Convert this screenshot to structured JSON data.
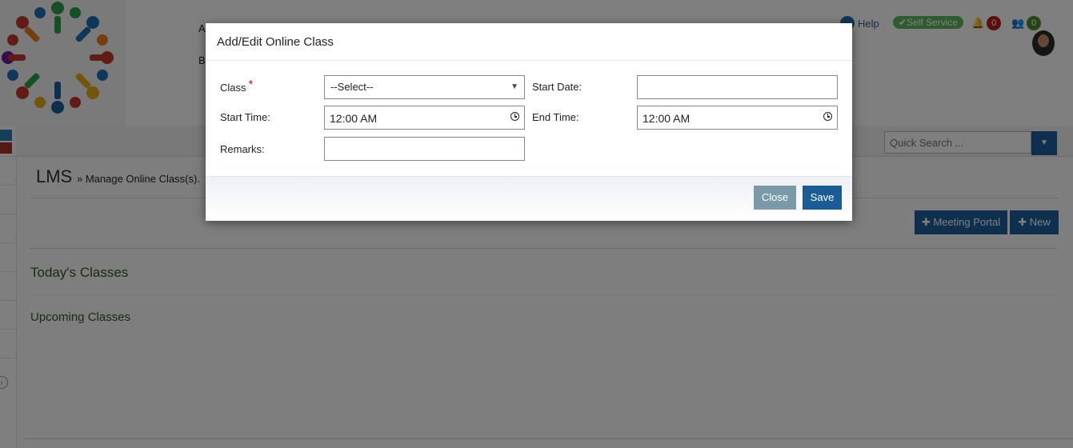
{
  "header": {
    "frag_a": "A",
    "frag_b": "B",
    "help_label": "Help",
    "self_service_label": "✔Self Service",
    "notifications_count": "0",
    "users_count": "0"
  },
  "search": {
    "placeholder": "Quick Search ..."
  },
  "page": {
    "title": "LMS",
    "breadcrumb": "» Manage Online Class(s).",
    "meeting_portal_label": "✚ Meeting Portal",
    "new_label": "✚ New",
    "todays_classes": "Today's Classes",
    "upcoming_classes": "Upcoming Classes"
  },
  "modal": {
    "title": "Add/Edit Online Class",
    "class_label": "Class",
    "required_mark": "*",
    "class_value": "--Select--",
    "start_date_label": "Start Date:",
    "start_date_value": "",
    "start_time_label": "Start Time:",
    "start_time_value": "12:00 AM",
    "end_time_label": "End Time:",
    "end_time_value": "12:00 AM",
    "remarks_label": "Remarks:",
    "remarks_value": "",
    "close_label": "Close",
    "save_label": "Save"
  },
  "colors": {
    "primary": "#1f5e9e",
    "success": "#5cb85c",
    "badge_red": "#b71c1c",
    "badge_green": "#4a8a2a",
    "heading_green": "#2d5a1e"
  },
  "icons": [
    "help-icon",
    "bell-icon",
    "users-icon",
    "clock-icon",
    "caret-down-icon",
    "plus-icon"
  ]
}
